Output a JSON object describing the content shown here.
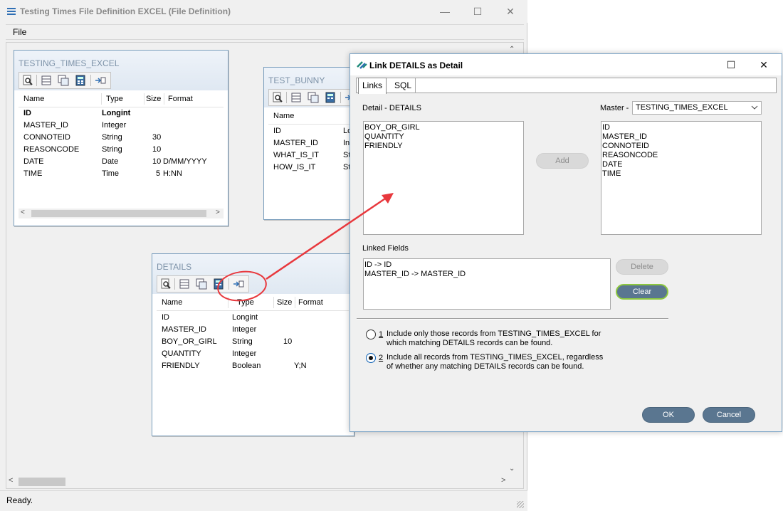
{
  "main_window": {
    "title": "Testing Times File Definition EXCEL (File Definition)",
    "menu": [
      "File"
    ],
    "status": "Ready."
  },
  "panels": {
    "testing_times": {
      "title": "TESTING_TIMES_EXCEL",
      "columns": [
        "Name",
        "Type",
        "Size",
        "Format"
      ],
      "rows": [
        {
          "name": "ID",
          "type": "Longint",
          "size": "",
          "format": ""
        },
        {
          "name": "MASTER_ID",
          "type": "Integer",
          "size": "",
          "format": ""
        },
        {
          "name": "CONNOTEID",
          "type": "String",
          "size": "30",
          "format": ""
        },
        {
          "name": "REASONCODE",
          "type": "String",
          "size": "10",
          "format": ""
        },
        {
          "name": "DATE",
          "type": "Date",
          "size": "10",
          "format": "D/MM/YYYY"
        },
        {
          "name": "TIME",
          "type": "Time",
          "size": "5",
          "format": "H:NN"
        }
      ]
    },
    "test_bunny": {
      "title": "TEST_BUNNY",
      "columns": [
        "Name"
      ],
      "rows": [
        {
          "name": "ID",
          "type": "Lo"
        },
        {
          "name": "MASTER_ID",
          "type": "In"
        },
        {
          "name": "WHAT_IS_IT",
          "type": "St"
        },
        {
          "name": "HOW_IS_IT",
          "type": "St"
        }
      ]
    },
    "details": {
      "title": "DETAILS",
      "columns": [
        "Name",
        "Type",
        "Size",
        "Format"
      ],
      "rows": [
        {
          "name": "ID",
          "type": "Longint",
          "size": "",
          "format": ""
        },
        {
          "name": "MASTER_ID",
          "type": "Integer",
          "size": "",
          "format": ""
        },
        {
          "name": "BOY_OR_GIRL",
          "type": "String",
          "size": "10",
          "format": ""
        },
        {
          "name": "QUANTITY",
          "type": "Integer",
          "size": "",
          "format": ""
        },
        {
          "name": "FRIENDLY",
          "type": "Boolean",
          "size": "",
          "format": "Y;N"
        }
      ]
    }
  },
  "dialog": {
    "title": "Link DETAILS as Detail",
    "tabs": [
      "Links",
      "SQL"
    ],
    "detail_label": "Detail - DETAILS",
    "detail_fields": [
      "BOY_OR_GIRL",
      "QUANTITY",
      "FRIENDLY"
    ],
    "master_label": "Master -",
    "master_selected": "TESTING_TIMES_EXCEL",
    "master_fields": [
      "ID",
      "MASTER_ID",
      "CONNOTEID",
      "REASONCODE",
      "DATE",
      "TIME"
    ],
    "add_label": "Add",
    "linked_label": "Linked Fields",
    "linked_fields": [
      "ID -> ID",
      "MASTER_ID -> MASTER_ID"
    ],
    "delete_label": "Delete",
    "clear_label": "Clear",
    "option1_num": "1",
    "option1_text": "Include only those records from TESTING_TIMES_EXCEL for which matching DETAILS records can be found.",
    "option2_num": "2",
    "option2_text": "Include all records from TESTING_TIMES_EXCEL, regardless of whether any matching DETAILS records can be found.",
    "selected_option": 2,
    "ok_label": "OK",
    "cancel_label": "Cancel"
  },
  "colors": {
    "annotation": "#e8383d",
    "panel_border": "#7a9ebd",
    "button_primary": "#5a7690",
    "clear_focus": "#8cc63f"
  }
}
